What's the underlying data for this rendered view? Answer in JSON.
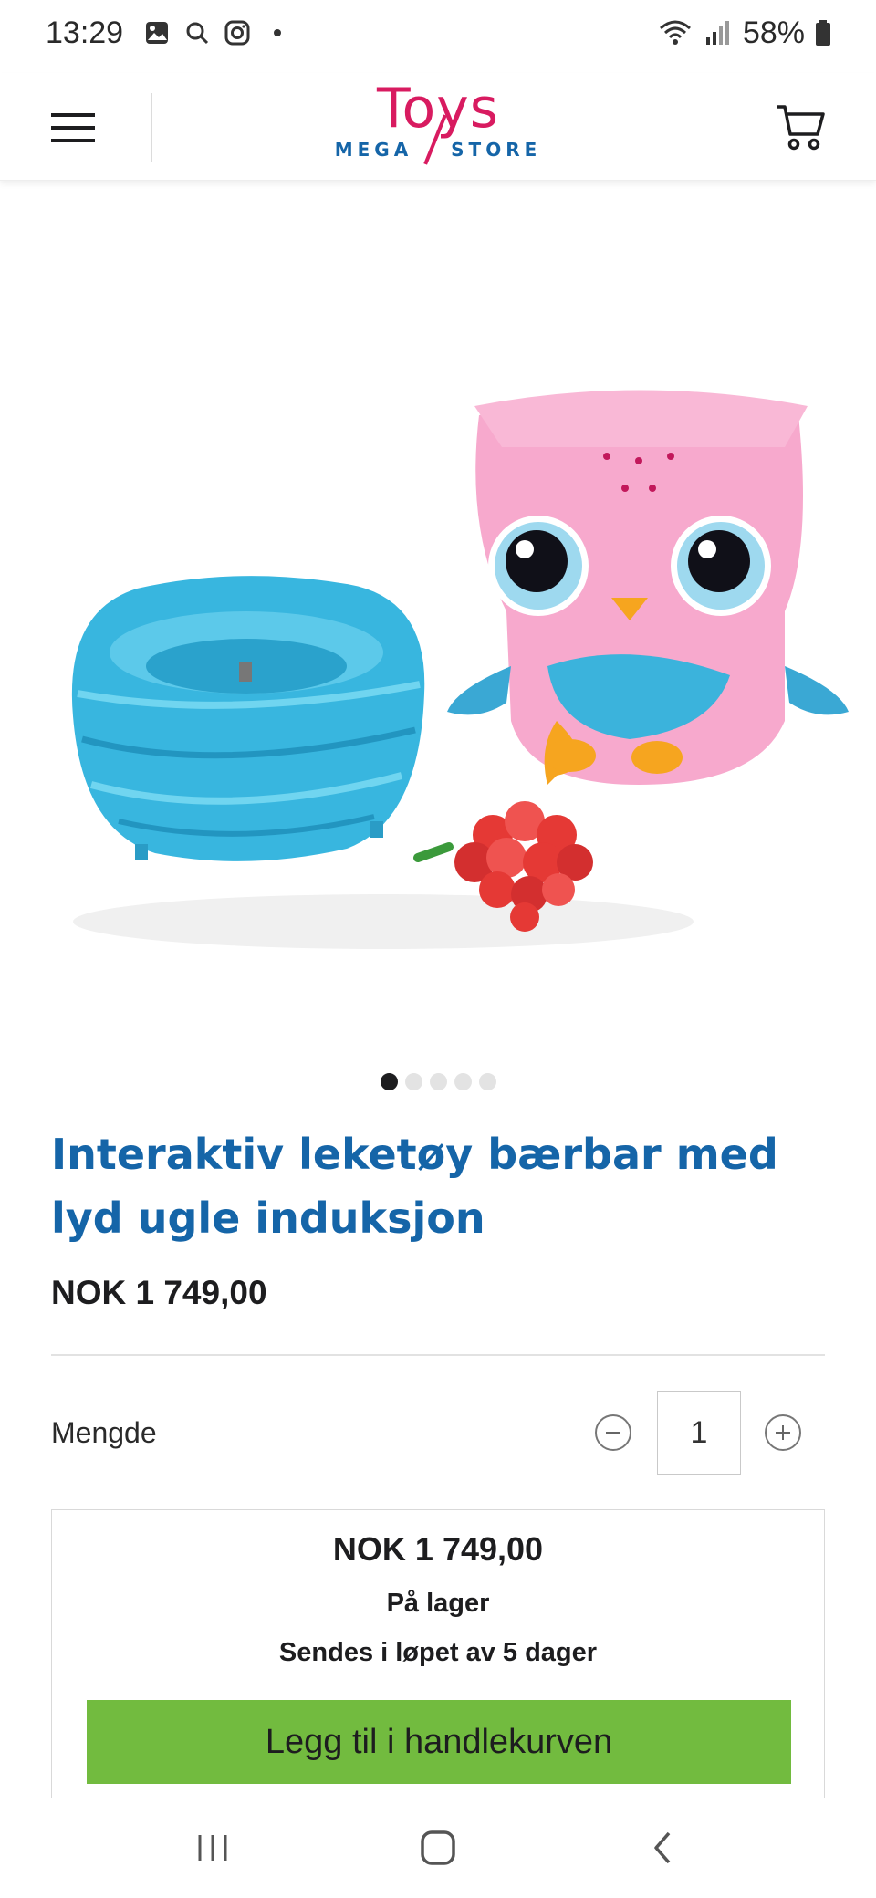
{
  "status_bar": {
    "time": "13:29",
    "battery": "58%",
    "icons": [
      "gallery-icon",
      "search-icon",
      "instagram-icon",
      "dot-icon",
      "wifi-icon",
      "signal-icon",
      "battery-icon"
    ]
  },
  "header": {
    "logo_main": "Toys",
    "logo_sub_left": "MEGA",
    "logo_sub_right": "STORE",
    "menu_icon": "hamburger-menu-icon",
    "cart_icon": "shopping-cart-icon",
    "brand_colors": {
      "pink": "#d81b60",
      "blue": "#1565a8"
    }
  },
  "carousel": {
    "total": 5,
    "active_index": 0
  },
  "product": {
    "title": "Interaktiv leketøy bærbar med lyd ugle induksjon",
    "price": "NOK 1 749,00",
    "title_color": "#1565a8"
  },
  "quantity": {
    "label": "Mengde",
    "value": "1"
  },
  "buy_box": {
    "price": "NOK 1 749,00",
    "stock": "På lager",
    "shipping": "Sendes i løpet av 5 dager",
    "button_label": "Legg til i handlekurven",
    "button_color": "#72bb3f"
  },
  "nav_bar": {
    "icons": [
      "recent-apps-icon",
      "home-icon",
      "back-icon"
    ]
  }
}
